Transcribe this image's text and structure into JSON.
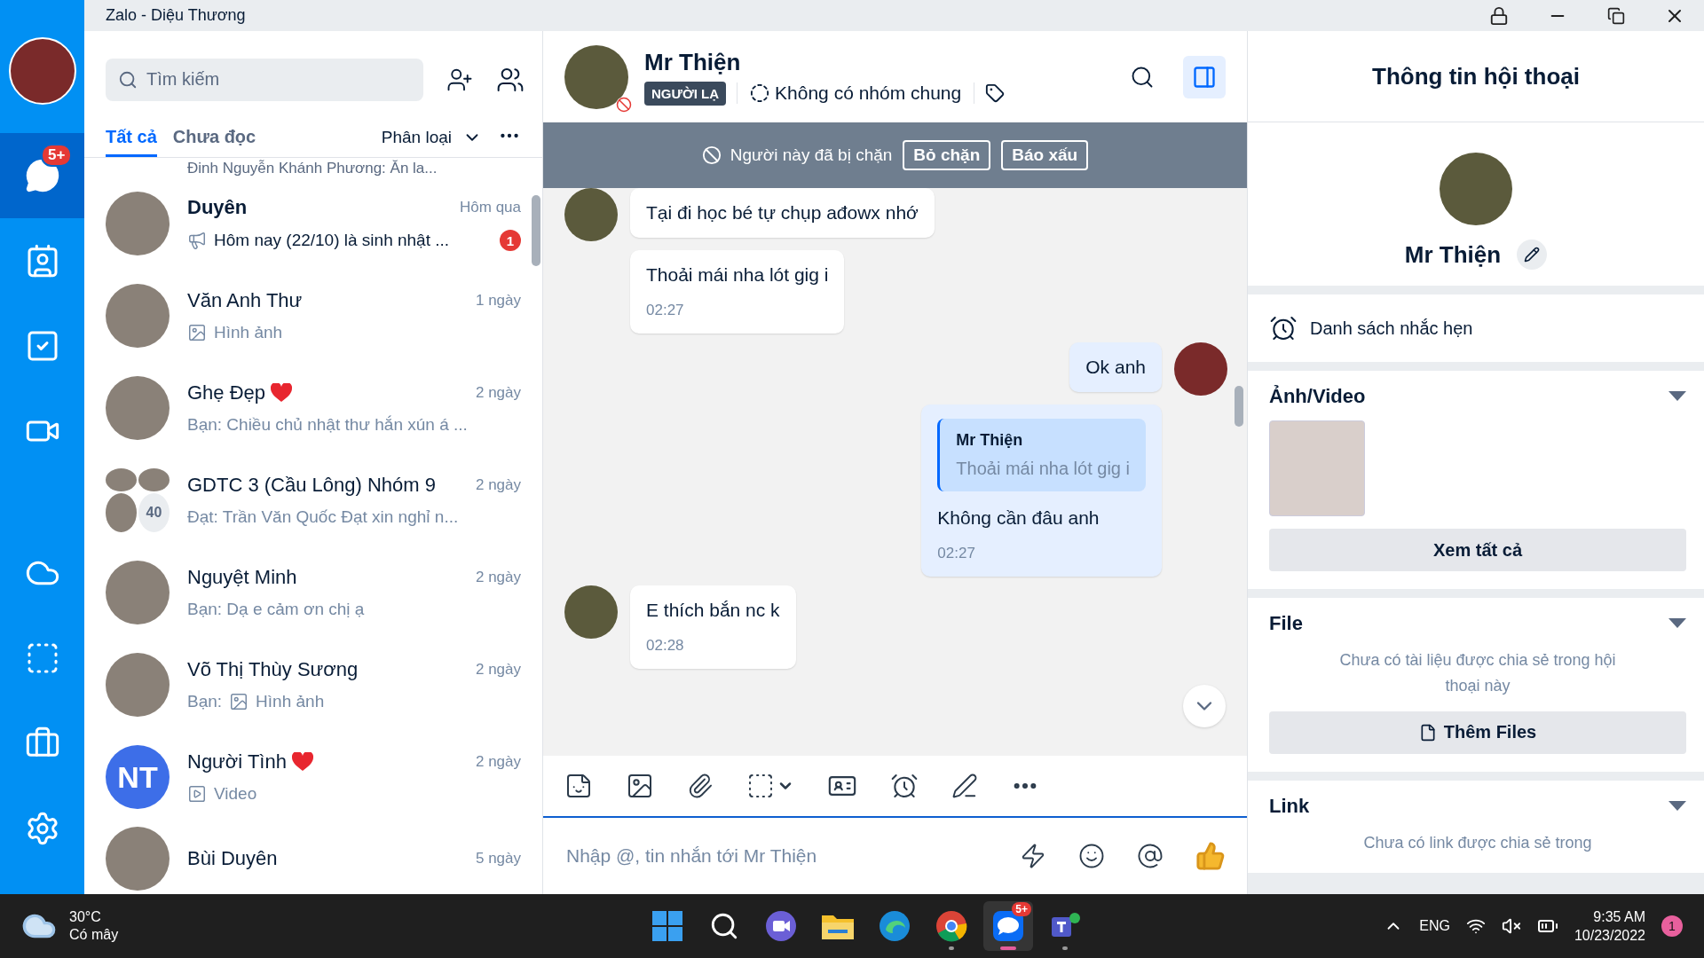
{
  "window": {
    "title": "Zalo - Diệu Thương"
  },
  "nav": {
    "items": [
      {
        "kind": "chat",
        "selected": true,
        "badge": "5+"
      },
      {
        "kind": "contacts",
        "selected": false
      },
      {
        "kind": "todo",
        "selected": false
      },
      {
        "kind": "video",
        "selected": false
      },
      {
        "kind": "cloud",
        "selected": false
      },
      {
        "kind": "capture",
        "selected": false
      },
      {
        "kind": "toolbox",
        "selected": false
      },
      {
        "kind": "settings",
        "selected": false
      }
    ]
  },
  "chat_list": {
    "search": {
      "placeholder": "Tìm kiếm"
    },
    "tabs": [
      {
        "label": "Tất cả",
        "selected": true
      },
      {
        "label": "Chưa đọc",
        "selected": false
      }
    ],
    "filter": "Phân loại",
    "clipped_preview": "Đinh Nguyễn Khánh Phương: Ăn la...",
    "conversations": [
      {
        "name": "Duyên",
        "time": "Hôm qua",
        "preview": "Hôm nay (22/10) là sinh nhật ...",
        "preview_icon": {
          "kind": "megaphone"
        },
        "unread": "1",
        "avatar": {
          "kind": "photo"
        },
        "heart": false
      },
      {
        "name": "Văn Anh Thư",
        "time": "1 ngày",
        "preview": "Hình ảnh",
        "preview_icon": {
          "kind": "image"
        },
        "avatar": {
          "kind": "photo"
        },
        "heart": false
      },
      {
        "name": "Ghẹ Đẹp",
        "time": "2 ngày",
        "preview": "Bạn: Chiều chủ nhật thư hắn xún á ...",
        "avatar": {
          "kind": "photo"
        },
        "heart": true
      },
      {
        "name": "GDTC 3 (Cầu Lông) Nhóm 9",
        "time": "2 ngày",
        "preview": "Đạt: Trần Văn Quốc Đạt xin nghỉ n...",
        "avatar": {
          "kind": "group",
          "member_count": "40"
        },
        "heart": false
      },
      {
        "name": "Nguyệt Minh",
        "time": "2 ngày",
        "preview": "Bạn: Dạ e cảm ơn chị ạ",
        "avatar": {
          "kind": "photo"
        },
        "heart": false
      },
      {
        "name": "Võ Thị Thùy Sương",
        "time": "2 ngày",
        "preview_prefix": "Bạn:",
        "preview": "Hình ảnh",
        "preview_icon": {
          "kind": "image"
        },
        "avatar": {
          "kind": "photo"
        },
        "heart": false
      },
      {
        "name": "Người Tình",
        "time": "2 ngày",
        "preview": "Video",
        "preview_icon": {
          "kind": "video"
        },
        "avatar": {
          "kind": "initials",
          "initials": "NT"
        },
        "heart": true
      },
      {
        "name": "Bùi Duyên",
        "time": "5 ngày",
        "avatar": {
          "kind": "photo"
        },
        "heart": false
      }
    ]
  },
  "chat": {
    "name": "Mr Thiện",
    "tag": "NGƯỜI LẠ",
    "groups": "Không có nhóm chung",
    "info_panel_open": true,
    "blocked": {
      "text": "Người này đã bị chặn",
      "buttons": [
        "Bỏ chặn",
        "Báo xấu"
      ]
    },
    "messages": [
      {
        "outgoing": false,
        "avatar": true,
        "text": "Tại đi học bé tự chụp ađowx nhớ"
      },
      {
        "outgoing": false,
        "avatar": false,
        "text": "Thoải mái nha lót gig i",
        "time": "02:27"
      },
      {
        "outgoing": true,
        "avatar": true,
        "text": "Ok anh"
      },
      {
        "outgoing": true,
        "avatar": false,
        "quote": {
          "author": "Mr Thiện",
          "text": "Thoải mái nha lót gig i"
        },
        "text": "Không cần đâu anh",
        "time": "02:27"
      },
      {
        "outgoing": false,
        "avatar": true,
        "text": "E thích bắn nc k",
        "time": "02:28"
      }
    ],
    "composer": {
      "placeholder": "Nhập @, tin nhắn tới Mr Thiện"
    }
  },
  "info": {
    "title": "Thông tin hội thoại",
    "name": "Mr Thiện",
    "reminders": "Danh sách nhắc hẹn",
    "sections": [
      {
        "kind": "media",
        "title": "Ảnh/Video",
        "button": "Xem tất cả"
      },
      {
        "kind": "files",
        "title": "File",
        "empty": "Chưa có tài liệu được chia sẻ trong hội thoại này",
        "button": "Thêm Files"
      },
      {
        "kind": "links",
        "title": "Link",
        "empty": "Chưa có link được chia sẻ trong"
      }
    ]
  },
  "taskbar": {
    "temperature": "30°C",
    "weather": "Có mây",
    "apps": [
      {
        "kind": "start",
        "active": false
      },
      {
        "kind": "search",
        "active": false
      },
      {
        "kind": "meet",
        "active": false
      },
      {
        "kind": "explorer",
        "active": false
      },
      {
        "kind": "edge",
        "active": false
      },
      {
        "kind": "chrome",
        "active": false
      },
      {
        "kind": "zalo",
        "active": true,
        "badge": "5+"
      },
      {
        "kind": "teams",
        "active": false
      }
    ],
    "language": "ENG",
    "time": "9:35 AM",
    "date": "10/23/2022",
    "notifications": "1"
  }
}
